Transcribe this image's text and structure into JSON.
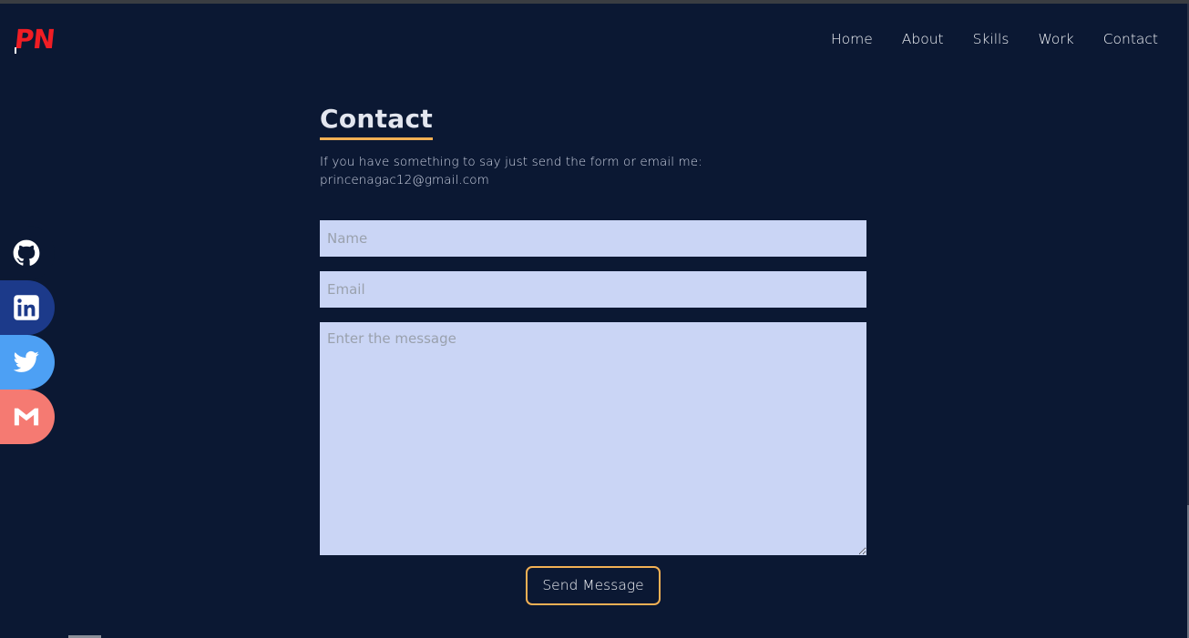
{
  "logo": {
    "text": "PN"
  },
  "nav": {
    "items": [
      {
        "label": "Home"
      },
      {
        "label": "About"
      },
      {
        "label": "Skills"
      },
      {
        "label": "Work"
      },
      {
        "label": "Contact"
      }
    ]
  },
  "social": {
    "items": [
      {
        "icon": "github-icon",
        "color": "#0b1833"
      },
      {
        "icon": "linkedin-icon",
        "color": "#1c3a8a"
      },
      {
        "icon": "twitter-icon",
        "color": "#4da0f4"
      },
      {
        "icon": "gmail-icon",
        "color": "#f57a72"
      }
    ]
  },
  "contact": {
    "title": "Contact",
    "description": "If you have something to say just send the form or email me: princenagac12@gmail.com",
    "form": {
      "name_placeholder": "Name",
      "name_value": "",
      "email_placeholder": "Email",
      "email_value": "",
      "message_placeholder": "Enter the message",
      "message_value": "",
      "submit_label": "Send Message"
    }
  },
  "colors": {
    "background": "#0b1833",
    "accent": "#f2b054",
    "logo": "#f01d24",
    "input_bg": "#cad5f5"
  }
}
